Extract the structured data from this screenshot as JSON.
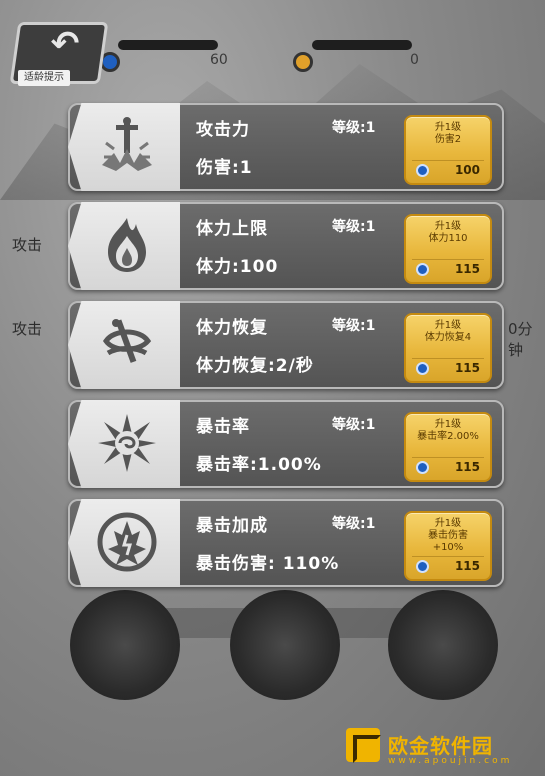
{
  "background": {
    "top_left_value": "60",
    "top_right_value": "0",
    "left_label_1": "攻击",
    "left_label_2": "攻击",
    "right_label": "0分钟",
    "back_tag": "适龄提示"
  },
  "skills": [
    {
      "name": "攻击力",
      "level": "等级:1",
      "stat": "伤害:1",
      "upgrade_title": "升1级",
      "upgrade_desc": "伤害2",
      "upgrade_desc2": "",
      "cost": "100",
      "icon": "sword-icon"
    },
    {
      "name": "体力上限",
      "level": "等级:1",
      "stat": "体力:100",
      "upgrade_title": "升1级",
      "upgrade_desc": "体力110",
      "upgrade_desc2": "",
      "cost": "115",
      "icon": "flame-icon"
    },
    {
      "name": "体力恢复",
      "level": "等级:1",
      "stat": "体力恢复:2/秒",
      "upgrade_title": "升1级",
      "upgrade_desc": "体力恢复4",
      "upgrade_desc2": "",
      "cost": "115",
      "icon": "sword-swirl-icon"
    },
    {
      "name": "暴击率",
      "level": "等级:1",
      "stat": "暴击率:1.00%",
      "upgrade_title": "升1级",
      "upgrade_desc": "暴击率2.00%",
      "upgrade_desc2": "",
      "cost": "115",
      "icon": "burst-icon"
    },
    {
      "name": "暴击加成",
      "level": "等级:1",
      "stat": "暴击伤害: 110%",
      "upgrade_title": "升1级",
      "upgrade_desc": "暴击伤害",
      "upgrade_desc2": "+10%",
      "cost": "115",
      "icon": "crest-icon"
    }
  ],
  "watermark": {
    "name": "欧金软件园",
    "url": "www.apoujin.com"
  }
}
